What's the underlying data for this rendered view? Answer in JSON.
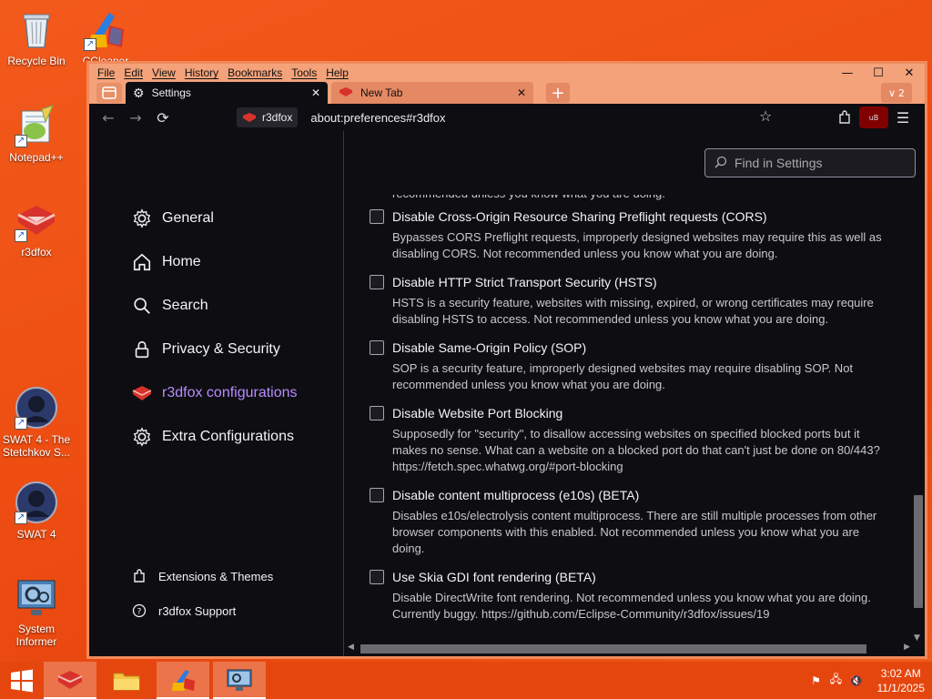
{
  "desktop": {
    "icons": [
      {
        "label": "Recycle Bin"
      },
      {
        "label": "CCleaner"
      },
      {
        "label": "Notepad++"
      },
      {
        "label": "r3dfox"
      },
      {
        "label": "SWAT 4 - The Stetchkov S..."
      },
      {
        "label": "SWAT 4"
      },
      {
        "label": "System Informer"
      }
    ]
  },
  "browser": {
    "menu": [
      "File",
      "Edit",
      "View",
      "History",
      "Bookmarks",
      "Tools",
      "Help"
    ],
    "tabs": [
      {
        "label": "Settings",
        "icon": "gear-icon"
      },
      {
        "label": "New Tab",
        "icon": "r3dfox-icon"
      }
    ],
    "tab_count": "2",
    "identity_label": "r3dfox",
    "url": "about:preferences#r3dfox",
    "search_placeholder": "Find in Settings"
  },
  "sidebar": {
    "items": [
      {
        "label": "General",
        "icon": "gear-icon"
      },
      {
        "label": "Home",
        "icon": "home-icon"
      },
      {
        "label": "Search",
        "icon": "search-icon"
      },
      {
        "label": "Privacy & Security",
        "icon": "lock-icon"
      },
      {
        "label": "r3dfox configurations",
        "icon": "r3dfox-icon",
        "selected": true
      },
      {
        "label": "Extra Configurations",
        "icon": "gear-icon"
      }
    ],
    "footer": [
      {
        "label": "Extensions & Themes",
        "icon": "puzzle-icon"
      },
      {
        "label": "r3dfox Support",
        "icon": "help-icon"
      }
    ]
  },
  "prefs": {
    "cut_top": "recommended unless you know what you are doing.",
    "items": [
      {
        "title": "Disable Cross-Origin Resource Sharing Preflight requests (CORS)",
        "desc1": "Bypasses CORS Preflight requests, improperly designed websites may require this as well as",
        "desc2": "disabling CORS. Not recommended unless you know what you are doing.",
        "checked": false
      },
      {
        "title": "Disable HTTP Strict Transport Security (HSTS)",
        "desc1": "HSTS is a security feature, websites with missing, expired, or wrong certificates may require",
        "desc2": "disabling HSTS to access. Not recommended unless you know what you are doing.",
        "checked": false
      },
      {
        "title": "Disable Same-Origin Policy (SOP)",
        "desc1": "SOP is a security feature, improperly designed websites may require disabling SOP. Not",
        "desc2": "recommended unless you know what you are doing.",
        "checked": false
      },
      {
        "title": "Disable Website Port Blocking",
        "desc1": "Supposedly for \"security\", to disallow accessing websites on specified blocked ports but it",
        "desc2": "makes no sense. What can a website on a blocked port do that can't just be done on 80/443?",
        "desc3": "https://fetch.spec.whatwg.org/#port-blocking",
        "checked": false
      },
      {
        "title": "Disable content multiprocess (e10s) (BETA)",
        "desc1": "Disables e10s/electrolysis content multiprocess. There are still multiple processes from other",
        "desc2": "browser components with this enabled. Not recommended unless you know what you are",
        "desc3": "doing.",
        "checked": false
      },
      {
        "title": "Use Skia GDI font rendering (BETA)",
        "desc1": "Disable DirectWrite font rendering. Not recommended unless you know what you are doing.",
        "desc2": "Currently buggy. https://github.com/Eclipse-Community/r3dfox/issues/19",
        "checked": false
      }
    ]
  },
  "taskbar": {
    "time": "3:02 AM",
    "date": "11/1/2025"
  },
  "colors": {
    "desktop": "#ee4e12",
    "accent_purple": "#b98cff",
    "content_bg": "#0e0d12"
  }
}
